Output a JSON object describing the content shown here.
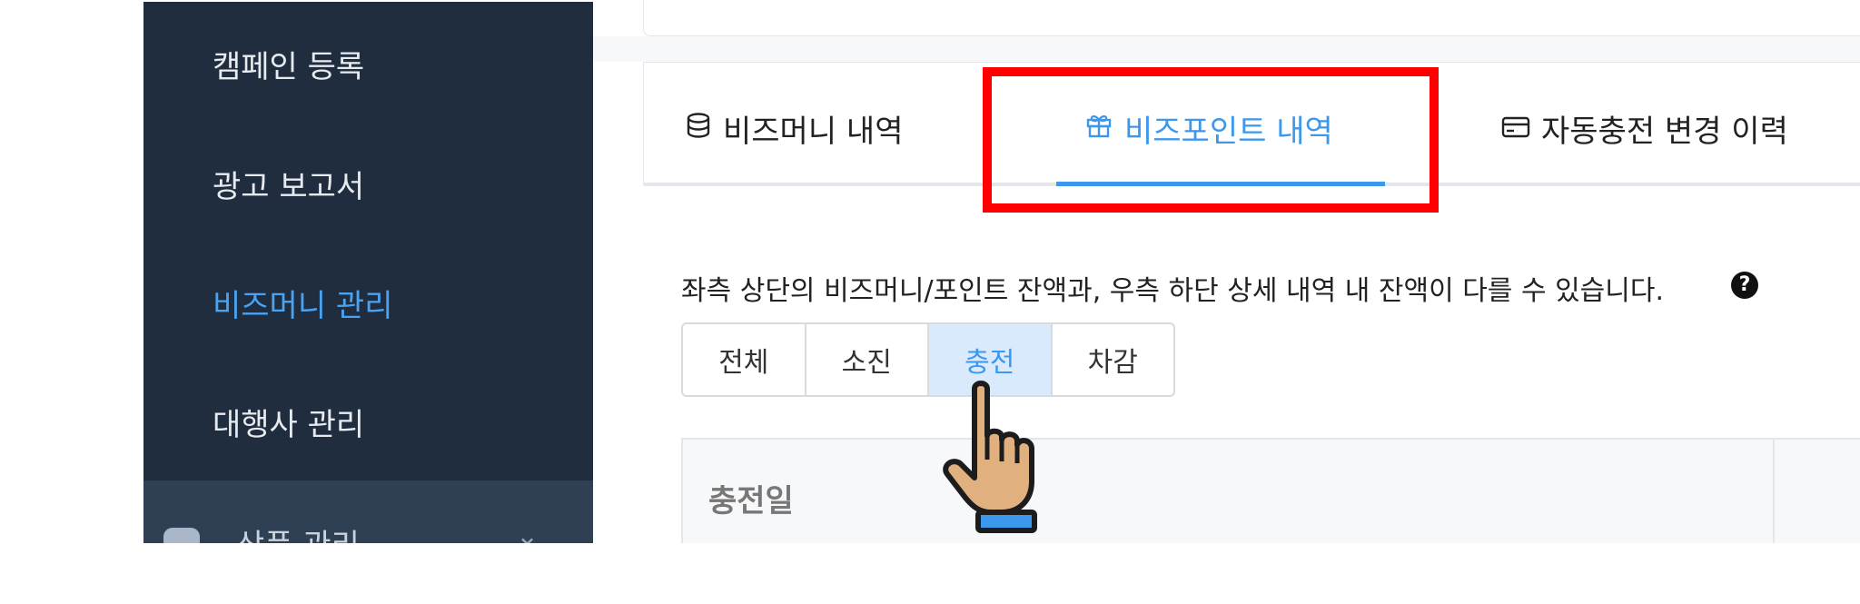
{
  "sidebar": {
    "items": [
      {
        "label": "캠페인 등록",
        "active": false
      },
      {
        "label": "광고 보고서",
        "active": false
      },
      {
        "label": "비즈머니 관리",
        "active": true
      },
      {
        "label": "대행사 관리",
        "active": false
      }
    ],
    "section": {
      "label": "상품 관리",
      "icon": "shirt-icon",
      "chevron": "chevron-down-icon"
    }
  },
  "tabs": [
    {
      "label": "비즈머니 내역",
      "icon": "coin-stack-icon",
      "active": false
    },
    {
      "label": "비즈포인트 내역",
      "icon": "gift-icon",
      "active": true
    },
    {
      "label": "자동충전 변경 이력",
      "icon": "card-icon",
      "active": false
    }
  ],
  "notice": "좌측 상단의 비즈머니/포인트 잔액과, 우측 하단 상세 내역 내 잔액이 다를 수 있습니다.",
  "help_icon_glyph": "?",
  "filter": {
    "options": [
      "전체",
      "소진",
      "충전",
      "차감"
    ],
    "selected": "충전"
  },
  "table": {
    "columns": [
      "충전일"
    ]
  },
  "colors": {
    "sidebar_bg": "#1f2d3e",
    "accent": "#3c98ec",
    "highlight": "#ff0000",
    "selected_seg_bg": "#d9eafc"
  }
}
